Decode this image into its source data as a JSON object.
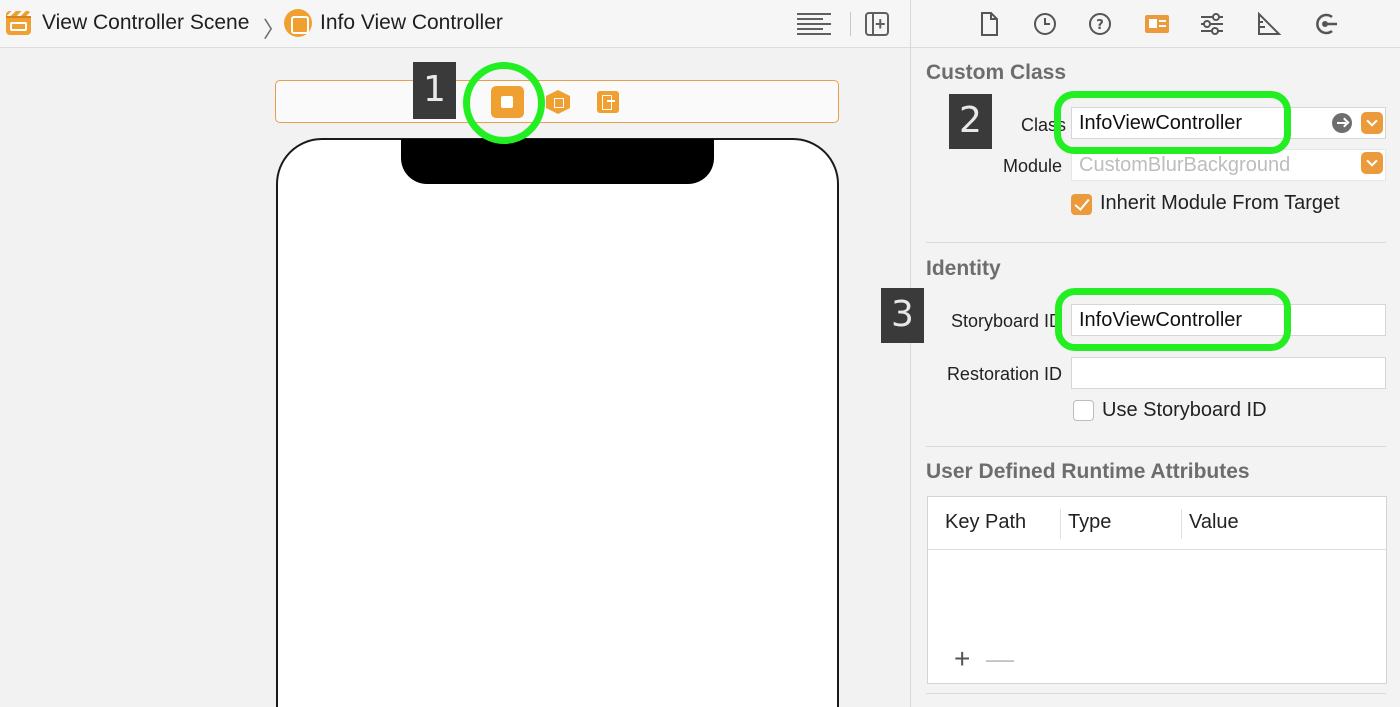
{
  "breadcrumb": {
    "scene_label": "View Controller Scene",
    "controller_label": "Info View Controller"
  },
  "inspector": {
    "tabs": [
      "file-icon",
      "history-icon",
      "help-icon",
      "identity-icon",
      "attributes-icon",
      "size-icon",
      "connections-icon"
    ],
    "selected_tab": "identity-icon",
    "custom_class": {
      "title": "Custom Class",
      "class_label": "Class",
      "class_value": "InfoViewController",
      "module_label": "Module",
      "module_placeholder": "CustomBlurBackground",
      "inherit_label": "Inherit Module From Target",
      "inherit_checked": true
    },
    "identity": {
      "title": "Identity",
      "storyboard_id_label": "Storyboard ID",
      "storyboard_id_value": "InfoViewController",
      "restoration_id_label": "Restoration ID",
      "restoration_id_value": "",
      "use_storyboard_id_label": "Use Storyboard ID",
      "use_storyboard_id_checked": false
    },
    "runtime_attributes": {
      "title": "User Defined Runtime Attributes",
      "columns": [
        "Key Path",
        "Type",
        "Value"
      ],
      "add_label": "+",
      "remove_label": "—"
    }
  },
  "annotations": {
    "step1": "1",
    "step2": "2",
    "step3": "3",
    "highlight_color": "#22ee22"
  },
  "colors": {
    "accent": "#f0a030",
    "badge": "#3a3a3a"
  }
}
